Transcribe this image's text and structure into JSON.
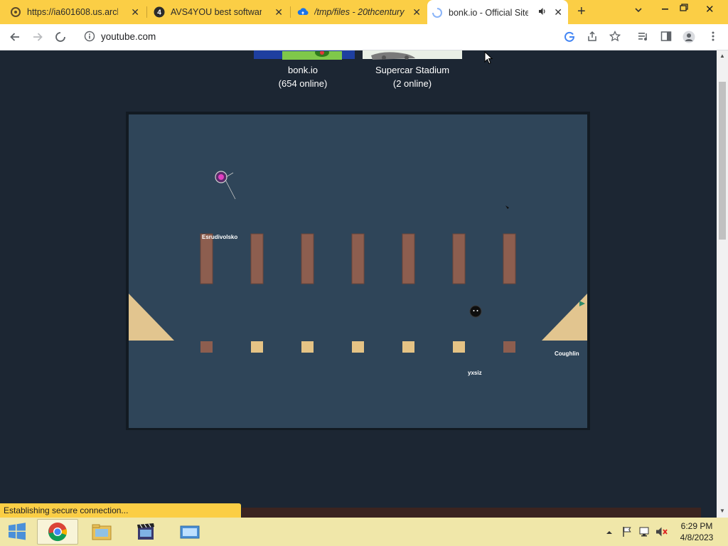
{
  "browser": {
    "tabs": [
      {
        "title": "https://ia601608.us.archiv",
        "favicon": "archive-favicon",
        "active": false
      },
      {
        "title": "AVS4YOU best software f",
        "favicon": "avs4you-favicon",
        "active": false
      },
      {
        "title": "/tmp/files - 20thcentury",
        "favicon": "cloud-upload-favicon",
        "active": false
      },
      {
        "title": "bonk.io - Official Site",
        "favicon": "loading-spinner",
        "active": true
      }
    ],
    "address": "youtube.com",
    "status_text": "Establishing secure connection..."
  },
  "content": {
    "servers": [
      {
        "name": "bonk.io",
        "online": "(654 online)"
      },
      {
        "name": "Supercar Stadium",
        "online": "(2 online)"
      }
    ],
    "game": {
      "players": [
        {
          "name": "Esrudivolsko"
        },
        {
          "name": "yxsiz"
        },
        {
          "name": "Coughlin"
        }
      ],
      "colors": {
        "background": "#2f4559",
        "frame": "#121a22",
        "pillar": "#8d5e4f",
        "block_light": "#e5c385",
        "block_dark": "#8d5e4f",
        "ramp": "#e2c58f"
      }
    }
  },
  "taskbar": {
    "apps": [
      "start-button",
      "chrome-icon",
      "file-explorer-icon",
      "video-editor-icon",
      "virtual-machine-icon"
    ],
    "time": "6:29 PM",
    "date": "4/8/2023"
  }
}
